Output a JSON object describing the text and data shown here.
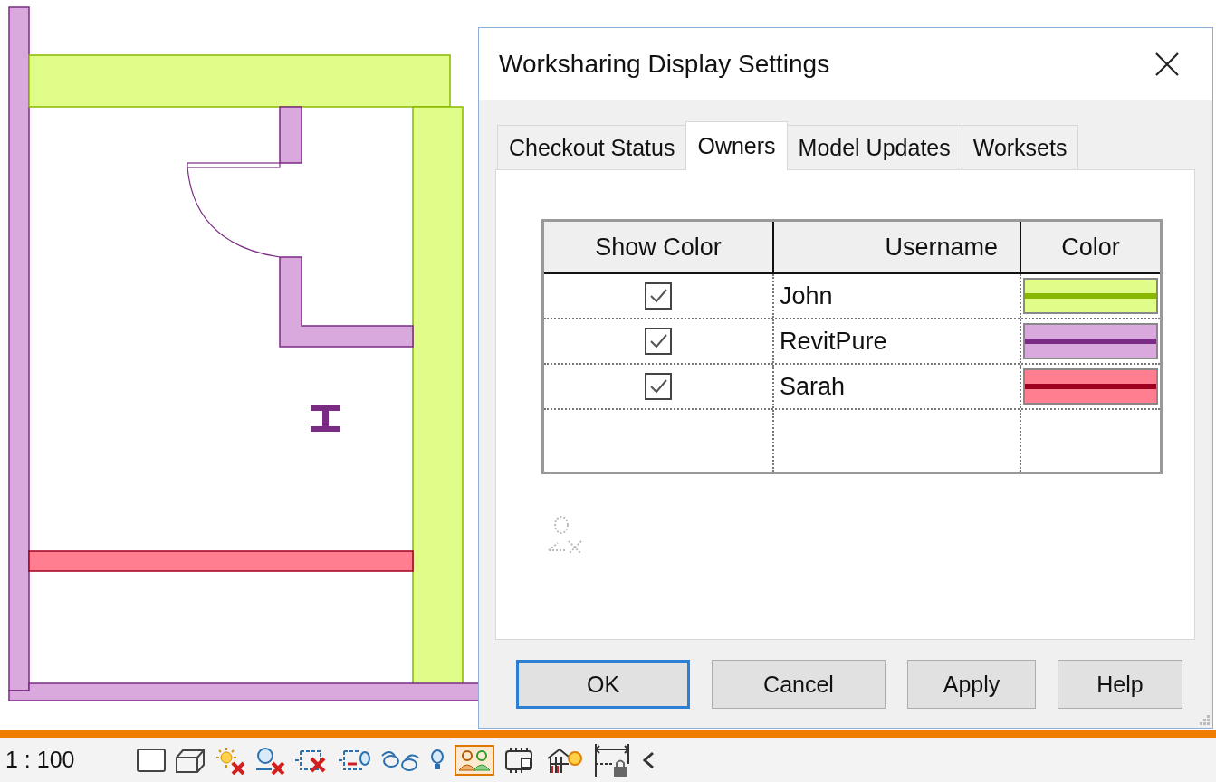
{
  "window": {
    "title": "Worksharing Display Settings"
  },
  "tabs": [
    {
      "label": "Checkout Status",
      "selected": false
    },
    {
      "label": "Owners",
      "selected": true
    },
    {
      "label": "Model Updates",
      "selected": false
    },
    {
      "label": "Worksets",
      "selected": false
    }
  ],
  "table": {
    "columns": [
      "Show Color",
      "Username",
      "Color"
    ],
    "rows": [
      {
        "show_color": true,
        "username": "John",
        "color": "#e0fd8a",
        "line": {
          "color": "#88b800"
        }
      },
      {
        "show_color": true,
        "username": "RevitPure",
        "color": "#d9a8dc",
        "line": {
          "color": "#7a2c84"
        }
      },
      {
        "show_color": true,
        "username": "Sarah",
        "color": "#ff7f90",
        "line": {
          "color": "#a00020"
        }
      }
    ]
  },
  "buttons": [
    {
      "label": "OK",
      "default": true
    },
    {
      "label": "Cancel",
      "default": false
    },
    {
      "label": "Apply",
      "default": false
    },
    {
      "label": "Help",
      "default": false
    }
  ],
  "status_bar": {
    "scale": "1 : 100",
    "worksharing_display_on": true
  }
}
